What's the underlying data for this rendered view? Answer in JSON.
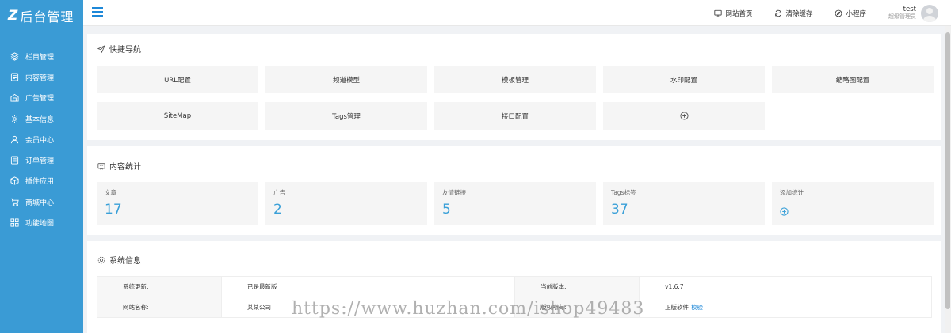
{
  "sidebar": {
    "logo_mark": "Z",
    "logo_text": "后台管理",
    "items": [
      {
        "label": "栏目管理",
        "icon": "layers-icon"
      },
      {
        "label": "内容管理",
        "icon": "document-icon"
      },
      {
        "label": "广告管理",
        "icon": "ad-icon"
      },
      {
        "label": "基本信息",
        "icon": "gear-icon"
      },
      {
        "label": "会员中心",
        "icon": "user-icon"
      },
      {
        "label": "订单管理",
        "icon": "order-icon"
      },
      {
        "label": "插件应用",
        "icon": "cube-icon"
      },
      {
        "label": "商城中心",
        "icon": "cart-icon"
      },
      {
        "label": "功能地图",
        "icon": "grid-icon"
      }
    ]
  },
  "topbar": {
    "links": [
      {
        "label": "网站首页",
        "icon": "monitor-icon"
      },
      {
        "label": "清除缓存",
        "icon": "refresh-icon"
      },
      {
        "label": "小程序",
        "icon": "compass-icon"
      }
    ],
    "user_name": "test",
    "user_role": "超级管理员"
  },
  "quick_nav": {
    "title": "快捷导航",
    "buttons": [
      "URL配置",
      "频道模型",
      "模板管理",
      "水印配置",
      "缩略图配置",
      "SiteMap",
      "Tags管理",
      "接口配置"
    ],
    "add_icon": "plus-circle-icon"
  },
  "content_stats": {
    "title": "内容统计",
    "cards": [
      {
        "label": "文章",
        "value": "17"
      },
      {
        "label": "广告",
        "value": "2"
      },
      {
        "label": "友情链接",
        "value": "5"
      },
      {
        "label": "Tags标签",
        "value": "37"
      }
    ],
    "add_label": "添加统计"
  },
  "system_info": {
    "title": "系统信息",
    "rows": [
      {
        "label1": "系统更新:",
        "value1": "已是最新版",
        "label2": "当前版本:",
        "value2": "v1.6.7"
      },
      {
        "label1": "网站名称:",
        "value1": "某某公司",
        "label2": "版权所有:",
        "value2": "正版软件",
        "link2": "校验"
      }
    ]
  },
  "watermark": "https://www.huzhan.com/ishop49483",
  "colors": {
    "sidebar": "#3a9bd5",
    "accent": "#1e88d8",
    "stat_value": "#3aa0d8"
  }
}
